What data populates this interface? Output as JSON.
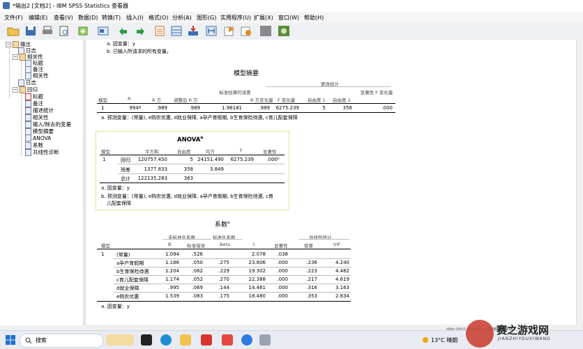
{
  "window": {
    "title": "*输出2 [文档2] - IBM SPSS Statistics 查看器"
  },
  "menu": [
    "文件(F)",
    "编辑(E)",
    "查看(V)",
    "数据(D)",
    "转换(T)",
    "插入(I)",
    "格式(O)",
    "分析(A)",
    "图形(G)",
    "实用程序(U)",
    "扩展(X)",
    "窗口(W)",
    "帮助(H)"
  ],
  "toolbar_icons": [
    "open-icon",
    "save-icon",
    "print-icon",
    "print-preview-icon",
    "export-icon",
    "recall-dialog-icon",
    "undo-icon",
    "redo-icon",
    "goto-data-icon",
    "goto-case-icon",
    "goto-variable-icon",
    "insert-heading-icon",
    "insert-title-icon",
    "insert-text-icon",
    "hide-icon",
    "show-icon"
  ],
  "tree": {
    "output": "输出",
    "log1": "日志",
    "correlations": "相关性",
    "corr_title": "标题",
    "corr_notes": "备注",
    "corr_table": "相关性",
    "log2": "日志",
    "regression": "回归",
    "reg_title": "标题",
    "reg_notes": "备注",
    "reg_desc": "描述统计",
    "reg_corr": "相关性",
    "reg_vars": "输入/除去的变量",
    "reg_summary": "模型摘要",
    "reg_anova": "ANOVA",
    "reg_coef": "系数",
    "reg_collin": "共线性诊断"
  },
  "prev_notes": {
    "a": "a. 因变量：y",
    "b": "b. 已输入所请求的所有变量。"
  },
  "model_summary": {
    "title": "模型摘要",
    "group_header": "更改统计",
    "headers": [
      "模型",
      "R",
      "R 方",
      "调整后 R 方",
      "标准估算的误差",
      "R 方变化量",
      "F 变化量",
      "自由度 1",
      "自由度 2",
      "显著性 F 变化量"
    ],
    "row": [
      "1",
      "994ª",
      ".989",
      ".989",
      "1.96181",
      ".989",
      "6275.239",
      "5",
      "358",
      ".000"
    ],
    "note": "a. 预测变量：(常量), e购农优惠, d就业保障, a孕产育假期, b生育保险待遇, c育儿配套保障"
  },
  "anova": {
    "title": "ANOVA",
    "sup": "a",
    "headers": [
      "模型",
      "",
      "平方和",
      "自由度",
      "均方",
      "F",
      "显著性"
    ],
    "rows": [
      [
        "1",
        "回归",
        "120757.450",
        "5",
        "24151.490",
        "6275.239",
        ".000ᵇ"
      ],
      [
        "",
        "残差",
        "1377.833",
        "358",
        "3.849",
        "",
        ""
      ],
      [
        "",
        "总计",
        "122135.283",
        "363",
        "",
        "",
        ""
      ]
    ],
    "note_a": "a. 因变量：y",
    "note_b1": "b. 预测变量：(常量), e购农优惠, d就业保障, a孕产育假期, b生育保险待遇, c育",
    "note_b2": "儿配套保障"
  },
  "coefficients": {
    "title": "系数",
    "sup": "a",
    "group_headers": [
      "未标准化系数",
      "标准化系数",
      "共线性统计"
    ],
    "headers": [
      "模型",
      "",
      "B",
      "标准错误",
      "Beta",
      "t",
      "显著性",
      "容差",
      "VIF"
    ],
    "rows": [
      [
        "1",
        "(常量)",
        "1.094",
        ".526",
        "",
        "2.078",
        ".038",
        "",
        ""
      ],
      [
        "",
        "a孕产育假期",
        "1.186",
        ".050",
        ".275",
        "23.806",
        ".000",
        ".236",
        "4.240"
      ],
      [
        "",
        "b生育保险待遇",
        "1.204",
        ".062",
        ".229",
        "19.302",
        ".000",
        ".223",
        "4.482"
      ],
      [
        "",
        "c育儿配套保障",
        "1.174",
        ".052",
        ".270",
        "22.388",
        ".000",
        ".217",
        "4.619"
      ],
      [
        "",
        "d就业保障",
        ".995",
        ".069",
        ".144",
        "14.461",
        ".000",
        ".316",
        "3.163"
      ],
      [
        "",
        "e购农优惠",
        "1.539",
        ".083",
        ".175",
        "18.480",
        ".000",
        ".353",
        "2.834"
      ]
    ],
    "note": "a. 因变量：y"
  },
  "status": "IBM SPSS Statistics 处理程序就绪",
  "taskbar": {
    "search": "搜索",
    "weather": "13°C 晴朗",
    "watermark": "赛之游戏网",
    "watermark_sub": "JIANZHIYOUXIWANG"
  }
}
